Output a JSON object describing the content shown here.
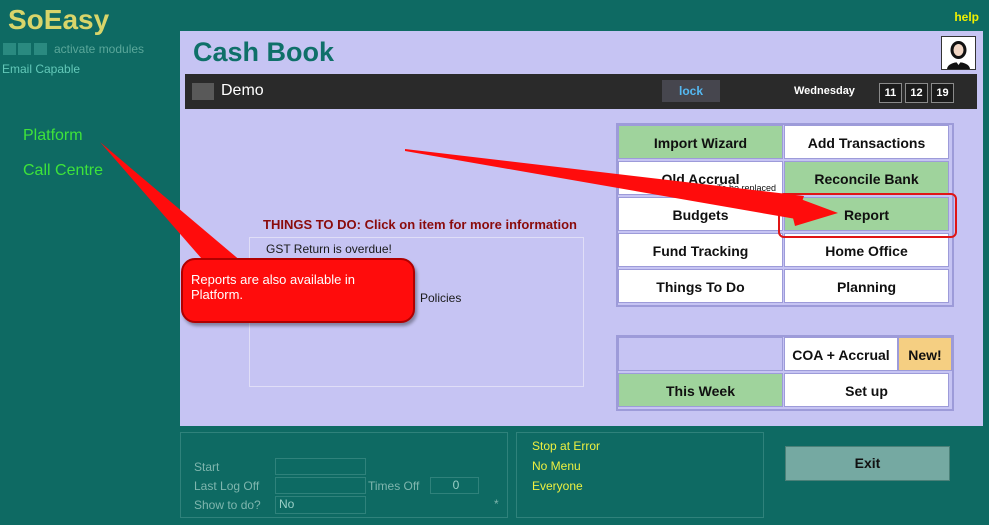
{
  "app": {
    "name": "SoEasy",
    "activate_modules": "activate modules",
    "email_capable": "Email Capable",
    "help": "help"
  },
  "nav": {
    "items": [
      {
        "label": "Platform"
      },
      {
        "label": "Call Centre"
      }
    ]
  },
  "page": {
    "title": "Cash Book",
    "company": "Demo",
    "lock": "lock",
    "day": "Wednesday",
    "date": [
      "11",
      "12",
      "19"
    ]
  },
  "todo": {
    "header": "THINGS TO DO: Click on item for more information",
    "items": [
      {
        "text": "GST Return is overdue!"
      },
      {
        "text": "Policies"
      }
    ]
  },
  "menu": {
    "buttons": [
      {
        "label": "Import Wizard",
        "style": "green"
      },
      {
        "label": "Add Transactions",
        "style": "white"
      },
      {
        "label": "Old Accrual",
        "style": "white",
        "note": "To be replaced"
      },
      {
        "label": "Reconcile Bank",
        "style": "green"
      },
      {
        "label": "Budgets",
        "style": "white"
      },
      {
        "label": "Report",
        "style": "green"
      },
      {
        "label": "Fund Tracking",
        "style": "white"
      },
      {
        "label": "Home Office",
        "style": "white"
      },
      {
        "label": "Things To Do",
        "style": "white"
      },
      {
        "label": "Planning",
        "style": "white"
      }
    ],
    "secondary": [
      {
        "label": "COA + Accrual",
        "style": "white"
      },
      {
        "label": "New!",
        "style": "orange"
      },
      {
        "label": "This Week",
        "style": "green"
      },
      {
        "label": "Set up",
        "style": "white"
      }
    ]
  },
  "callout": {
    "text": "Reports are also available in Platform."
  },
  "status": {
    "start_label": "Start",
    "start_value": "",
    "last_logoff_label": "Last Log Off",
    "last_logoff_value": "",
    "times_off_label": "Times Off",
    "times_off_value": "0",
    "show_todo_label": "Show to do?",
    "show_todo_value": "No",
    "asterisk": "*"
  },
  "options": {
    "items": [
      "Stop at Error",
      "No Menu",
      "Everyone"
    ]
  },
  "exit": "Exit",
  "colors": {
    "background": "#0e6a63",
    "panel": "#c6c4f3",
    "button_green": "#9fd39c",
    "button_orange": "#f5cf82",
    "callout": "#ff0c0c",
    "brand": "#d8d56a"
  }
}
